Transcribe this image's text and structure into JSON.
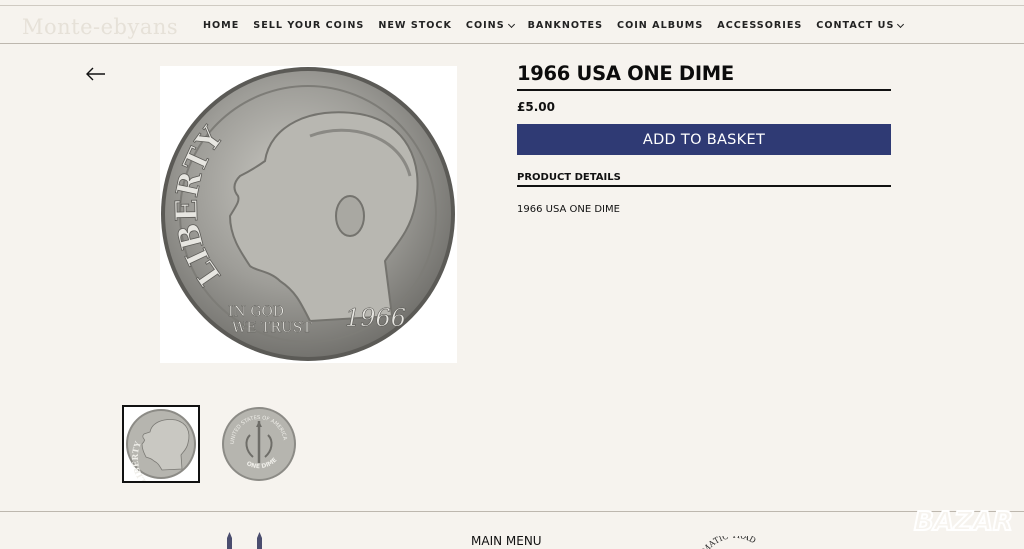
{
  "header": {
    "logo_text": "Monte-ebyans",
    "nav": [
      {
        "label": "HOME",
        "has_dropdown": false
      },
      {
        "label": "SELL YOUR COINS",
        "has_dropdown": false
      },
      {
        "label": "NEW STOCK",
        "has_dropdown": false
      },
      {
        "label": "COINS",
        "has_dropdown": true
      },
      {
        "label": "BANKNOTES",
        "has_dropdown": false
      },
      {
        "label": "COIN ALBUMS",
        "has_dropdown": false
      },
      {
        "label": "ACCESSORIES",
        "has_dropdown": false
      },
      {
        "label": "CONTACT US",
        "has_dropdown": true
      }
    ]
  },
  "product": {
    "title": "1966 USA ONE DIME",
    "price": "£5.00",
    "add_to_basket_label": "ADD TO BASKET",
    "details_heading": "PRODUCT DETAILS",
    "details_text": "1966 USA ONE DIME",
    "coin_obverse": {
      "legend": "LIBERTY",
      "motto": "IN GOD WE TRUST",
      "year": "1966"
    },
    "coin_reverse": {
      "legend": "UNITED STATES OF AMERICA",
      "denomination": "ONE DIME",
      "motto": "E PLURIBUS UNUM"
    }
  },
  "footer": {
    "main_menu_label": "MAIN MENU",
    "badge_text": "MATIC TRAD"
  },
  "watermark": {
    "text": "BAZAR"
  },
  "colors": {
    "background": "#f6f3ee",
    "button": "#2f3a74",
    "text": "#111111"
  }
}
